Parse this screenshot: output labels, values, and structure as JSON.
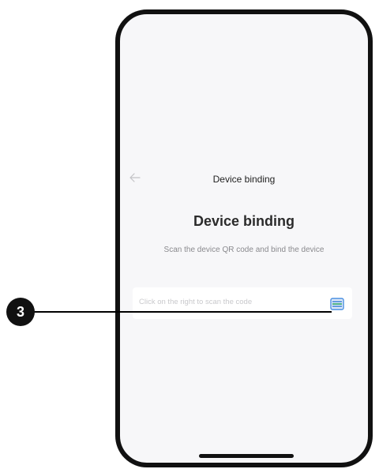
{
  "nav": {
    "back_icon": "arrow-left-icon",
    "title": "Device binding"
  },
  "main": {
    "heading": "Device binding",
    "subtitle": "Scan the device QR code and bind the device",
    "scan_field": {
      "placeholder": "Click on the right to scan the code",
      "scan_icon": "scan-code-icon"
    }
  },
  "callout": {
    "number": "3"
  },
  "colors": {
    "screen_background": "#f7f7f9",
    "frame": "#111111",
    "scan_icon_accent": "#4a90e2"
  }
}
